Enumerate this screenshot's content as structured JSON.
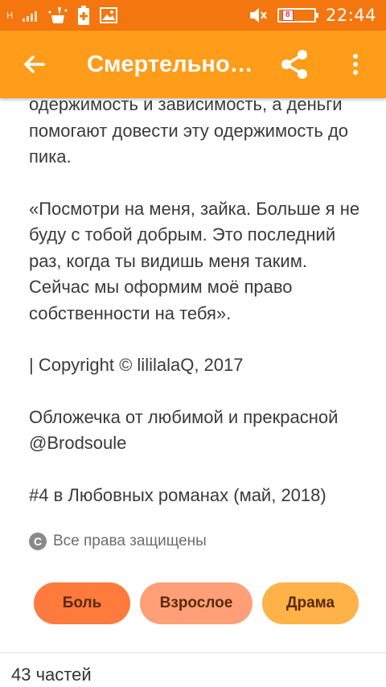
{
  "status_bar": {
    "network": "H",
    "battery_level": "8",
    "time": "22:44"
  },
  "toolbar": {
    "title": "Смертельно…"
  },
  "content": {
    "paragraphs": [
      "одержимость и зависимость, а деньги помогают довести эту одержимость до пика.",
      "«Посмотри на меня, зайка. Больше я не буду с тобой добрым. Это последний раз, когда ты видишь меня таким. Сейчас мы оформим моё право собственности на тебя».",
      "| Copyright © lililalaQ, 2017",
      "Обложечка от любимой и прекрасной @Brodsoule",
      "#4 в Любовных романах (май, 2018)"
    ]
  },
  "rights": {
    "icon_letter": "C",
    "text": "Все права защищены"
  },
  "tags": [
    {
      "label": "Боль",
      "color": "#ff7a3d"
    },
    {
      "label": "Взрослое",
      "color": "#ff9f78"
    },
    {
      "label": "Драма",
      "color": "#ffb247"
    }
  ],
  "footer": {
    "parts": "43 частей"
  },
  "colors": {
    "status_bar": "#f4760f",
    "toolbar": "#ff9c1a"
  }
}
